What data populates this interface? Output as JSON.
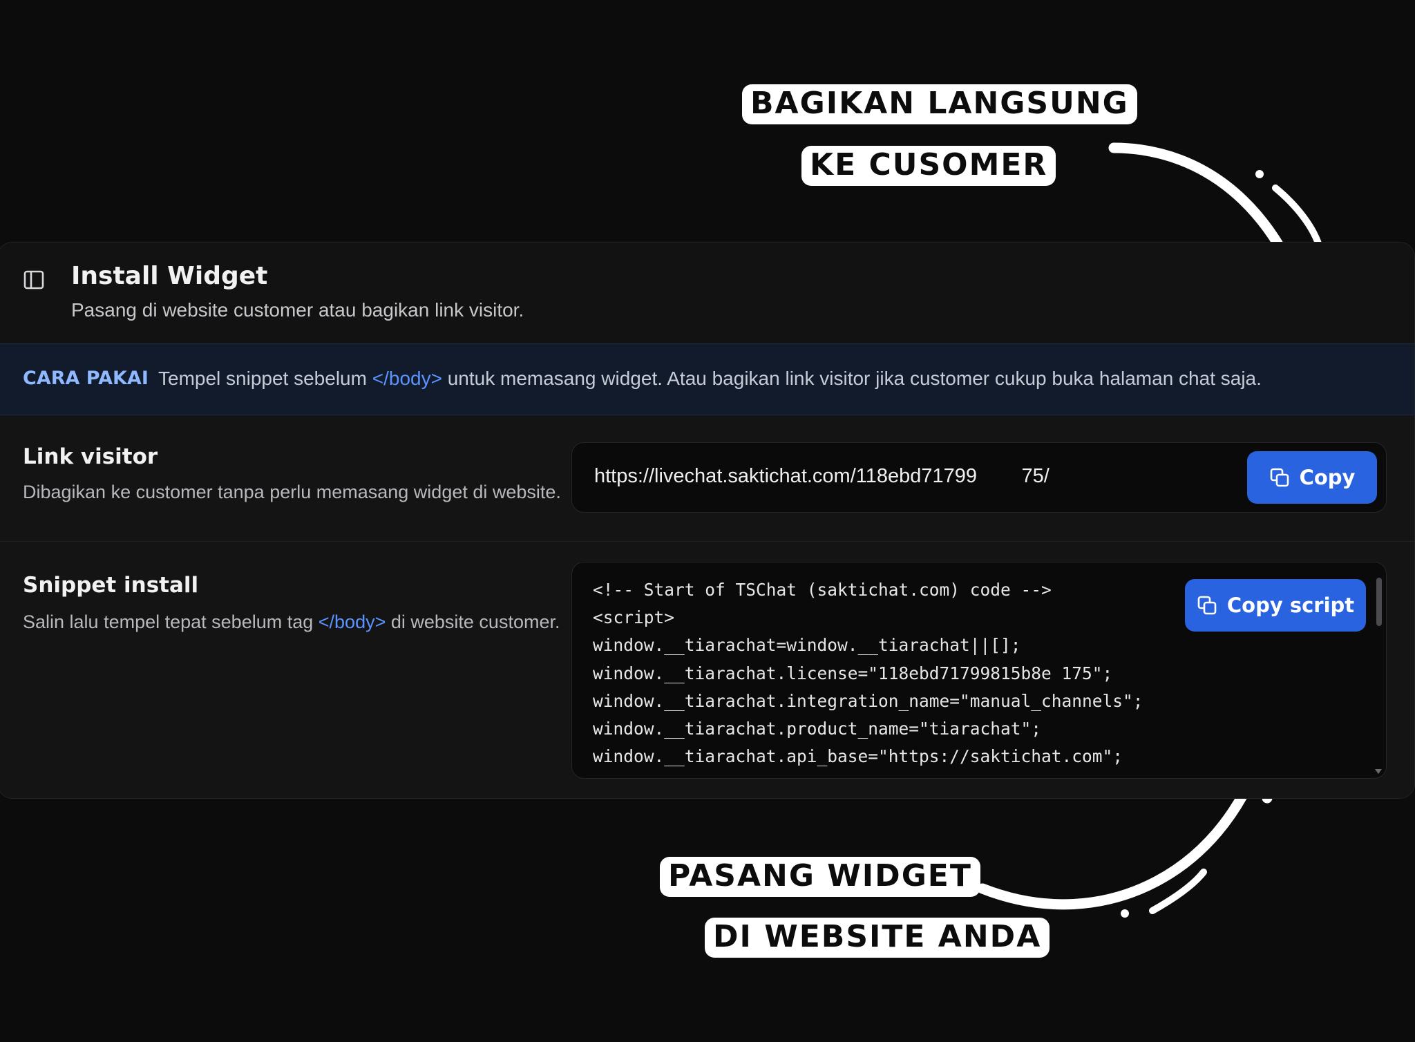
{
  "annotations": {
    "top_line1": "BAGIKAN LANGSUNG",
    "top_line2": "KE CUSOMER",
    "bottom_line1": "PASANG WIDGET",
    "bottom_line2": "DI WEBSITE ANDA"
  },
  "header": {
    "icon": "panel-icon",
    "title": "Install Widget",
    "subtitle": "Pasang di website customer atau bagikan link visitor."
  },
  "info": {
    "label": "CARA PAKAI",
    "text_before": "Tempel snippet sebelum ",
    "tag": "</body>",
    "text_after": " untuk memasang widget. Atau bagikan link visitor jika customer cukup buka halaman chat saja."
  },
  "link_visitor": {
    "title": "Link visitor",
    "description": "Dibagikan ke customer tanpa perlu memasang widget di website.",
    "url": "https://livechat.saktichat.com/118ebd71799        75/",
    "copy_label": "Copy",
    "copy_icon": "copy-icon"
  },
  "snippet": {
    "title": "Snippet install",
    "description_before": "Salin lalu tempel tepat sebelum tag ",
    "tag": "</body>",
    "description_after": " di website customer.",
    "code": "<!-- Start of TSChat (saktichat.com) code -->\n<script>\nwindow.__tiarachat=window.__tiarachat||[];\nwindow.__tiarachat.license=\"118ebd71799815b8e 175\";\nwindow.__tiarachat.integration_name=\"manual_channels\";\nwindow.__tiarachat.product_name=\"tiarachat\";\nwindow.__tiarachat.api_base=\"https://saktichat.com\";",
    "copy_label": "Copy script",
    "copy_icon": "copy-icon"
  },
  "colors": {
    "background": "#0c0c0d",
    "card": "#141415",
    "info_bar": "#111b2c",
    "accent": "#2a63e0",
    "tag": "#5b93ff",
    "info_label": "#8fb8ff"
  }
}
